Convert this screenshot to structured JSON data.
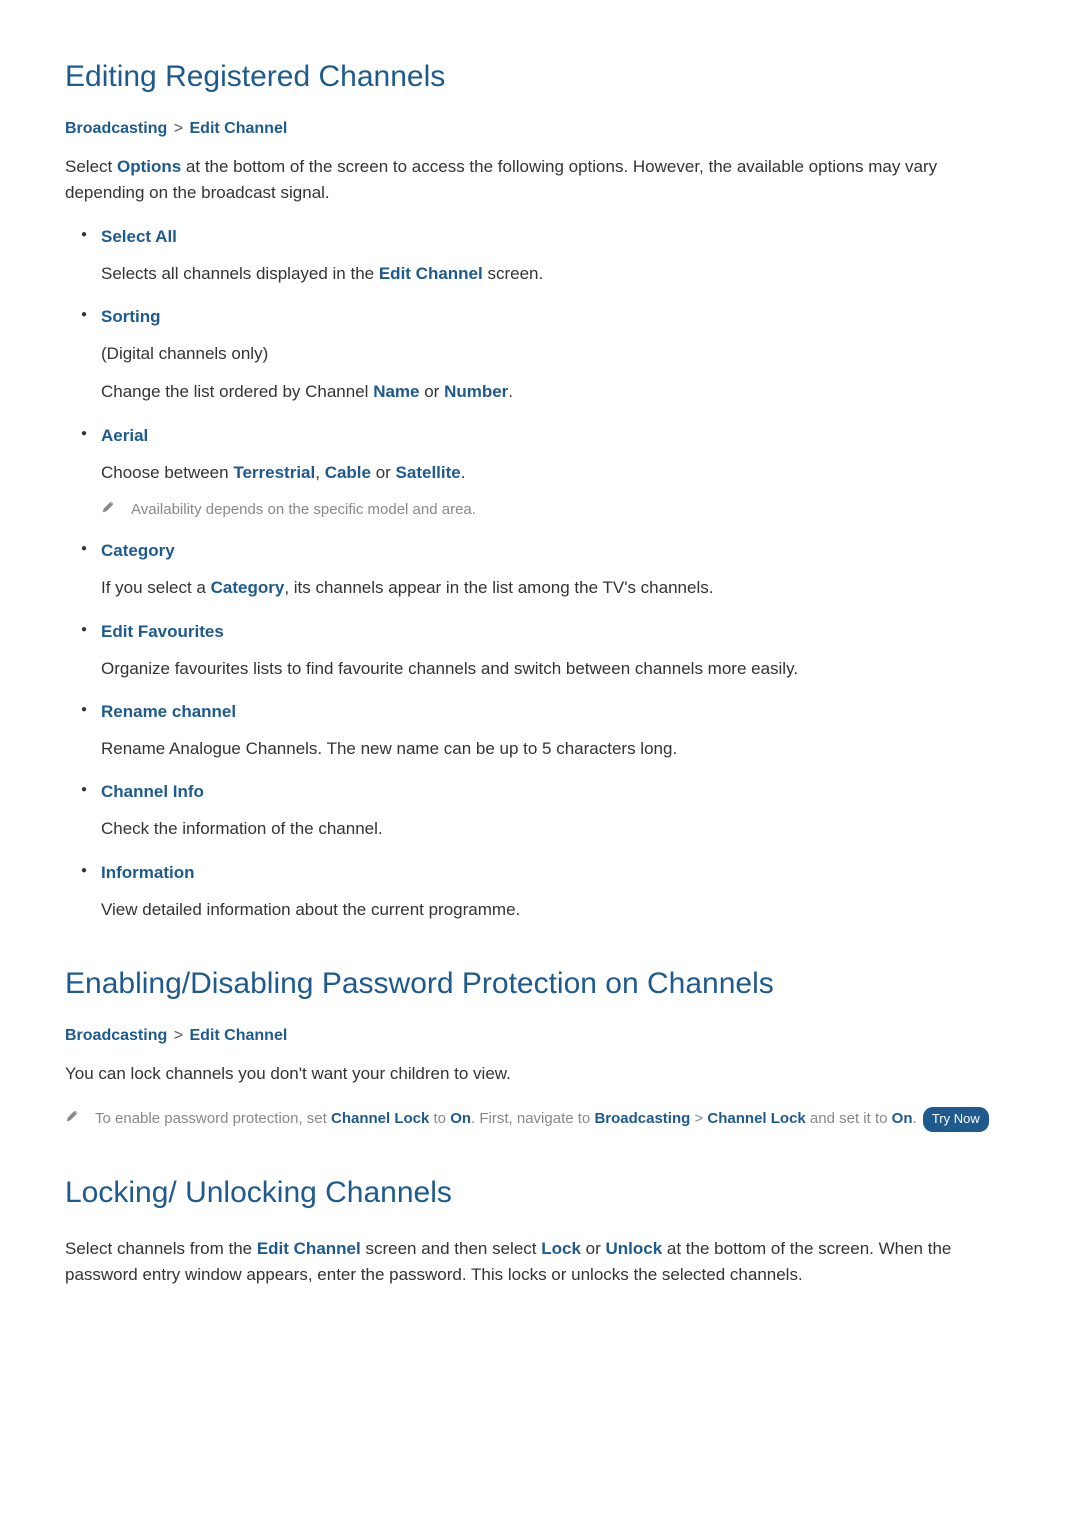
{
  "section1": {
    "title": "Editing Registered Channels",
    "breadcrumb": {
      "a": "Broadcasting",
      "b": "Edit Channel"
    },
    "intro_pre": "Select ",
    "intro_link": "Options",
    "intro_post": " at the bottom of the screen to access the following options. However, the available options may vary depending on the broadcast signal.",
    "options": [
      {
        "title": "Select All",
        "body_pre": "Selects all channels displayed in the ",
        "body_link1": "Edit Channel",
        "body_post": " screen."
      },
      {
        "title": "Sorting",
        "body_plain1": "(Digital channels only)",
        "body_pre": "Change the list ordered by Channel ",
        "body_link1": "Name",
        "body_mid": " or ",
        "body_link2": "Number",
        "body_post": "."
      },
      {
        "title": "Aerial",
        "body_pre": "Choose between ",
        "body_link1": "Terrestrial",
        "body_mid": ", ",
        "body_link2": "Cable",
        "body_mid2": " or ",
        "body_link3": "Satellite",
        "body_post": ".",
        "note": "Availability depends on the specific model and area."
      },
      {
        "title": "Category",
        "body_pre": "If you select a ",
        "body_link1": "Category",
        "body_post": ", its channels appear in the list among the TV's channels."
      },
      {
        "title": "Edit Favourites",
        "body_plain1": "Organize favourites lists to find favourite channels and switch between channels more easily."
      },
      {
        "title": "Rename channel",
        "body_plain1": "Rename Analogue Channels. The new name can be up to 5 characters long."
      },
      {
        "title": "Channel Info",
        "body_plain1": "Check the information of the channel."
      },
      {
        "title": "Information",
        "body_plain1": "View detailed information about the current programme."
      }
    ]
  },
  "section2": {
    "title": "Enabling/Disabling Password Protection on Channels",
    "breadcrumb": {
      "a": "Broadcasting",
      "b": "Edit Channel"
    },
    "intro": "You can lock channels you don't want your children to view.",
    "note_pre": "To enable password protection, set ",
    "note_l1": "Channel Lock",
    "note_mid1": " to ",
    "note_l2": "On",
    "note_mid2": ". First, navigate to ",
    "note_l3": "Broadcasting",
    "note_mid3": " > ",
    "note_l4": "Channel Lock",
    "note_mid4": " and set it to ",
    "note_l5": "On",
    "note_post": ". ",
    "try_now": "Try Now"
  },
  "section3": {
    "title": "Locking/ Unlocking Channels",
    "body_pre": "Select channels from the ",
    "body_l1": "Edit Channel",
    "body_mid1": " screen and then select ",
    "body_l2": "Lock",
    "body_mid2": " or ",
    "body_l3": "Unlock",
    "body_post": " at the bottom of the screen. When the password entry window appears, enter the password. This locks or unlocks the selected channels."
  }
}
